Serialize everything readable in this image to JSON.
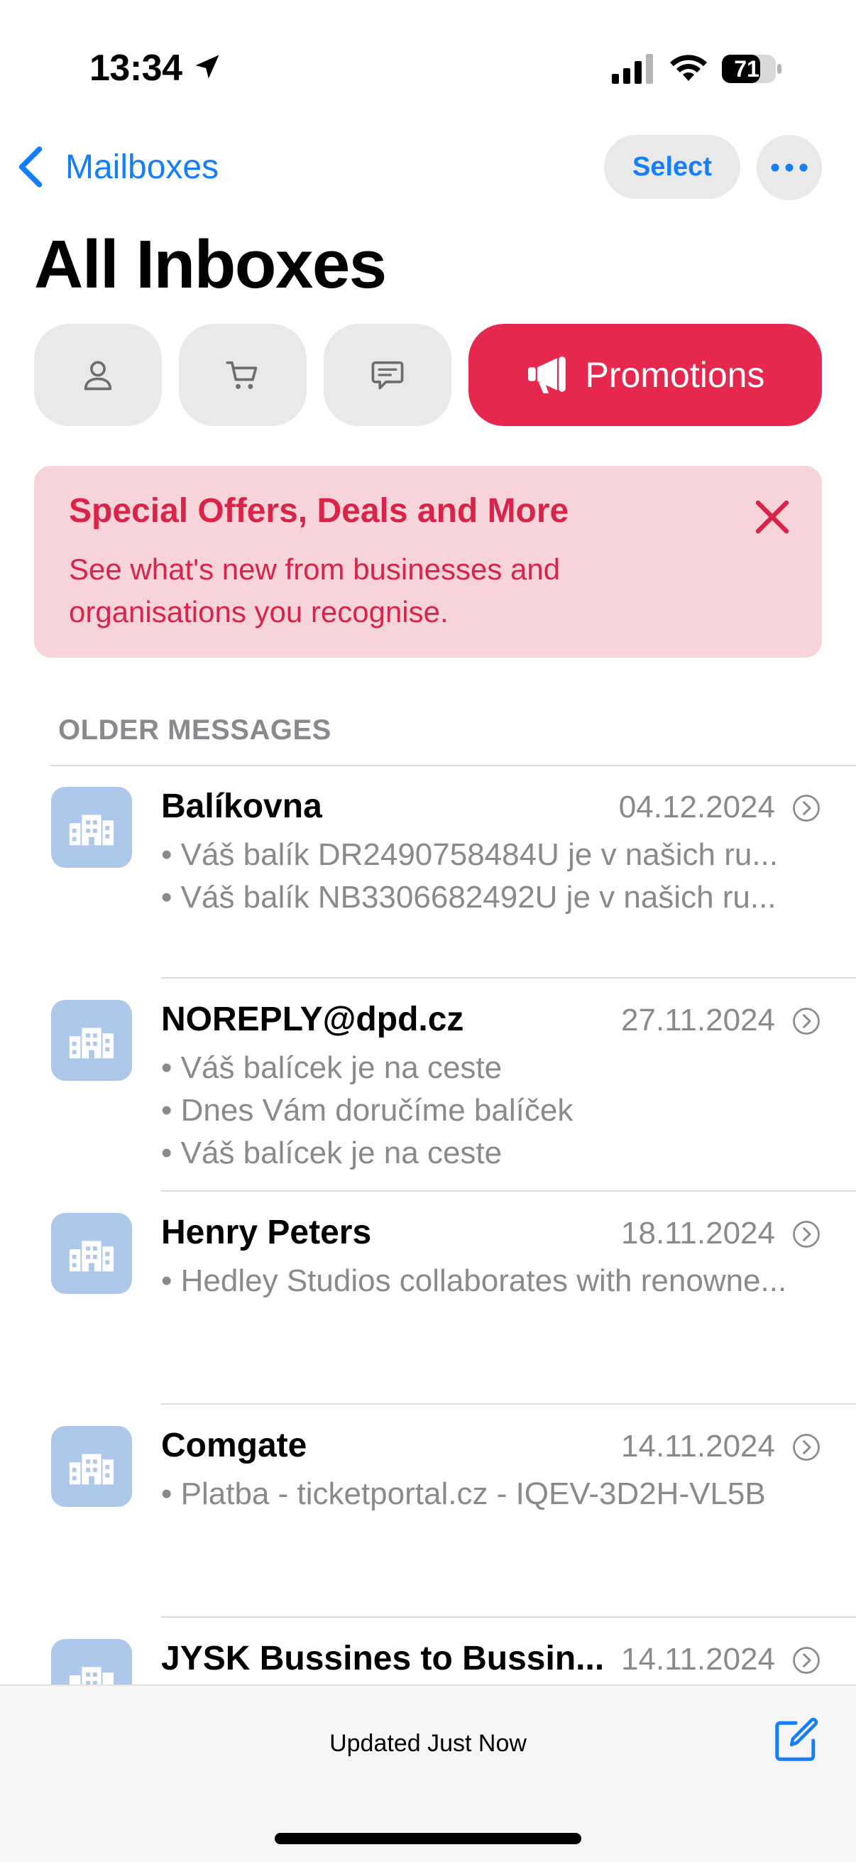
{
  "status_bar": {
    "time": "13:34",
    "battery_level": "71"
  },
  "nav": {
    "back_label": "Mailboxes",
    "select_label": "Select",
    "more_icon": "ellipsis-icon"
  },
  "title": "All Inboxes",
  "categories": [
    {
      "name": "primary",
      "icon": "person-icon",
      "active": false
    },
    {
      "name": "transactions",
      "icon": "cart-icon",
      "active": false
    },
    {
      "name": "updates",
      "icon": "chat-bubble-icon",
      "active": false
    },
    {
      "name": "promotions",
      "icon": "megaphone-icon",
      "label": "Promotions",
      "active": true
    }
  ],
  "banner": {
    "title": "Special Offers, Deals and More",
    "text": "See what's new from businesses and organisations you recognise."
  },
  "section_header": "OLDER MESSAGES",
  "messages": [
    {
      "sender": "Balíkovna",
      "date": "04.12.2024",
      "lines": [
        "• Váš balík DR2490758484U je v našich ru...",
        "• Váš balík NB3306682492U je v našich ru..."
      ]
    },
    {
      "sender": "NOREPLY@dpd.cz",
      "date": "27.11.2024",
      "lines": [
        "• Váš balícek je na ceste",
        "• Dnes Vám doručíme balíček",
        "• Váš balícek je na ceste"
      ]
    },
    {
      "sender": "Henry Peters",
      "date": "18.11.2024",
      "lines": [
        "• Hedley Studios collaborates with renowne..."
      ]
    },
    {
      "sender": "Comgate",
      "date": "14.11.2024",
      "lines": [
        "• Platba - ticketportal.cz - IQEV-3D2H-VL5B"
      ]
    },
    {
      "sender": "JYSK Bussines to Bussin...",
      "date": "14.11.2024",
      "lines": []
    }
  ],
  "toolbar": {
    "status": "Updated Just Now",
    "compose_icon": "compose-icon"
  },
  "colors": {
    "accent_blue": "#147efb",
    "promo_red": "#e6284f",
    "banner_bg": "#f7d3da",
    "avatar_bg": "#adc8ea"
  }
}
